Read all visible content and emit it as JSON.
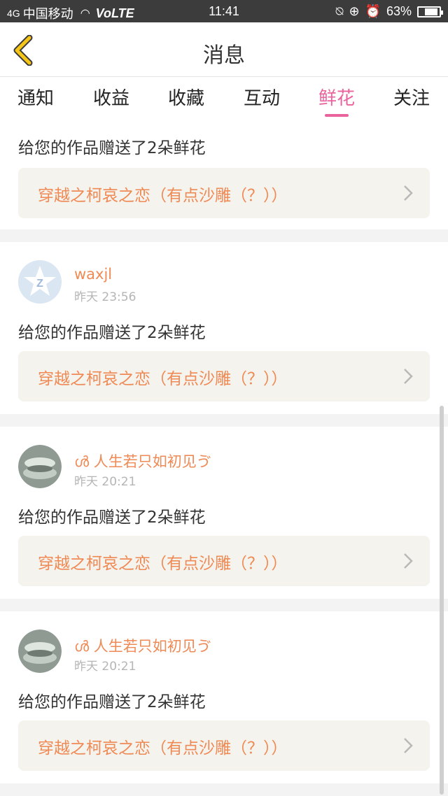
{
  "status_bar": {
    "signal": "4G",
    "carrier": "中国移动",
    "network": "VoLTE",
    "time": "11:41",
    "battery": "63%",
    "battery_level": 0.63
  },
  "header": {
    "title": "消息"
  },
  "tabs": [
    {
      "label": "通知",
      "active": false
    },
    {
      "label": "收益",
      "active": false
    },
    {
      "label": "收藏",
      "active": false
    },
    {
      "label": "互动",
      "active": false
    },
    {
      "label": "鲜花",
      "active": true
    },
    {
      "label": "关注",
      "active": false
    }
  ],
  "messages": [
    {
      "username": "",
      "time": "",
      "text": "给您的作品赠送了2朵鲜花",
      "work": "穿越之柯哀之恋（有点沙雕（？））"
    },
    {
      "username": "waxjl",
      "time": "昨天 23:56",
      "text": "给您的作品赠送了2朵鲜花",
      "work": "穿越之柯哀之恋（有点沙雕（？））"
    },
    {
      "username": "ൾ 人生若只如初见ゔ",
      "time": "昨天 20:21",
      "text": "给您的作品赠送了2朵鲜花",
      "work": "穿越之柯哀之恋（有点沙雕（？））"
    },
    {
      "username": "ൾ 人生若只如初见ゔ",
      "time": "昨天 20:21",
      "text": "给您的作品赠送了2朵鲜花",
      "work": "穿越之柯哀之恋（有点沙雕（？））"
    }
  ],
  "colors": {
    "accent": "#e9649d",
    "link": "#ef8a55",
    "back_arrow": "#f5c518"
  }
}
